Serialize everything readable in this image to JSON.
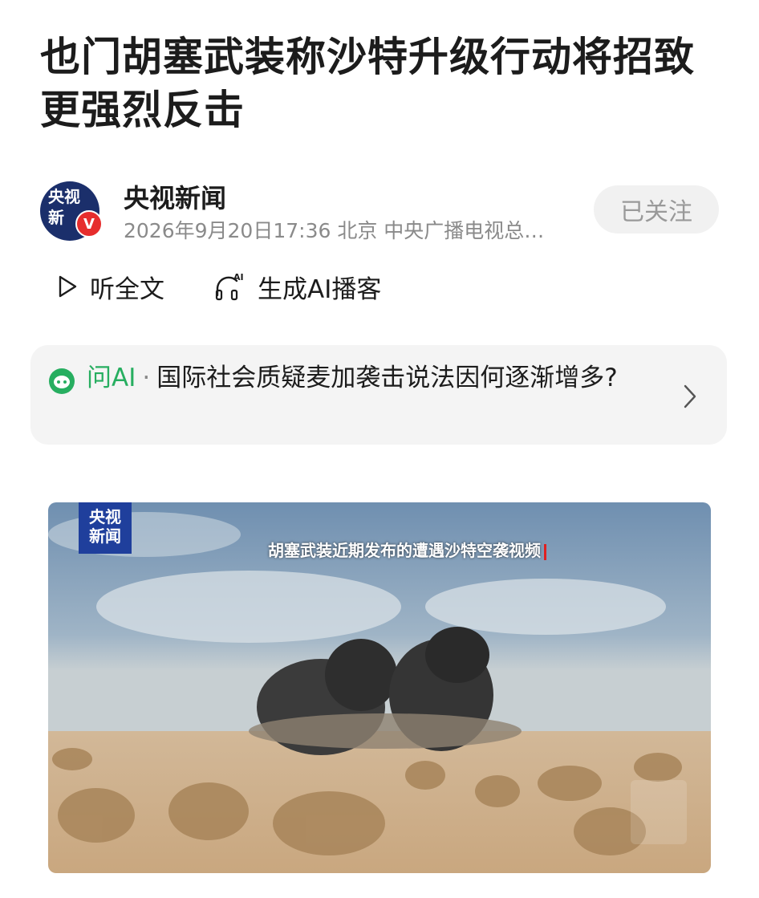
{
  "article": {
    "title": "也门胡塞武装称沙特升级行动将招致更强烈反击"
  },
  "source": {
    "avatar_line1": "央视",
    "avatar_line2": "新",
    "verified_badge": "V",
    "name": "央视新闻",
    "meta": "2026年9月20日17:36 北京 中央广播电视总…",
    "follow_label": "已关注"
  },
  "actions": {
    "listen_label": "听全文",
    "podcast_label": "生成AI播客",
    "podcast_icon_text": "AI"
  },
  "ai_question": {
    "label": "问AI",
    "dot": "·",
    "question": "国际社会质疑麦加袭击说法因何逐渐增多?"
  },
  "video": {
    "logo_line1": "央视",
    "logo_line2": "新闻",
    "caption": "胡塞武装近期发布的遭遇沙特空袭视频"
  },
  "colors": {
    "accent_green": "#27ae60",
    "logo_blue": "#1f3f9c",
    "badge_red": "#e62d2d"
  }
}
